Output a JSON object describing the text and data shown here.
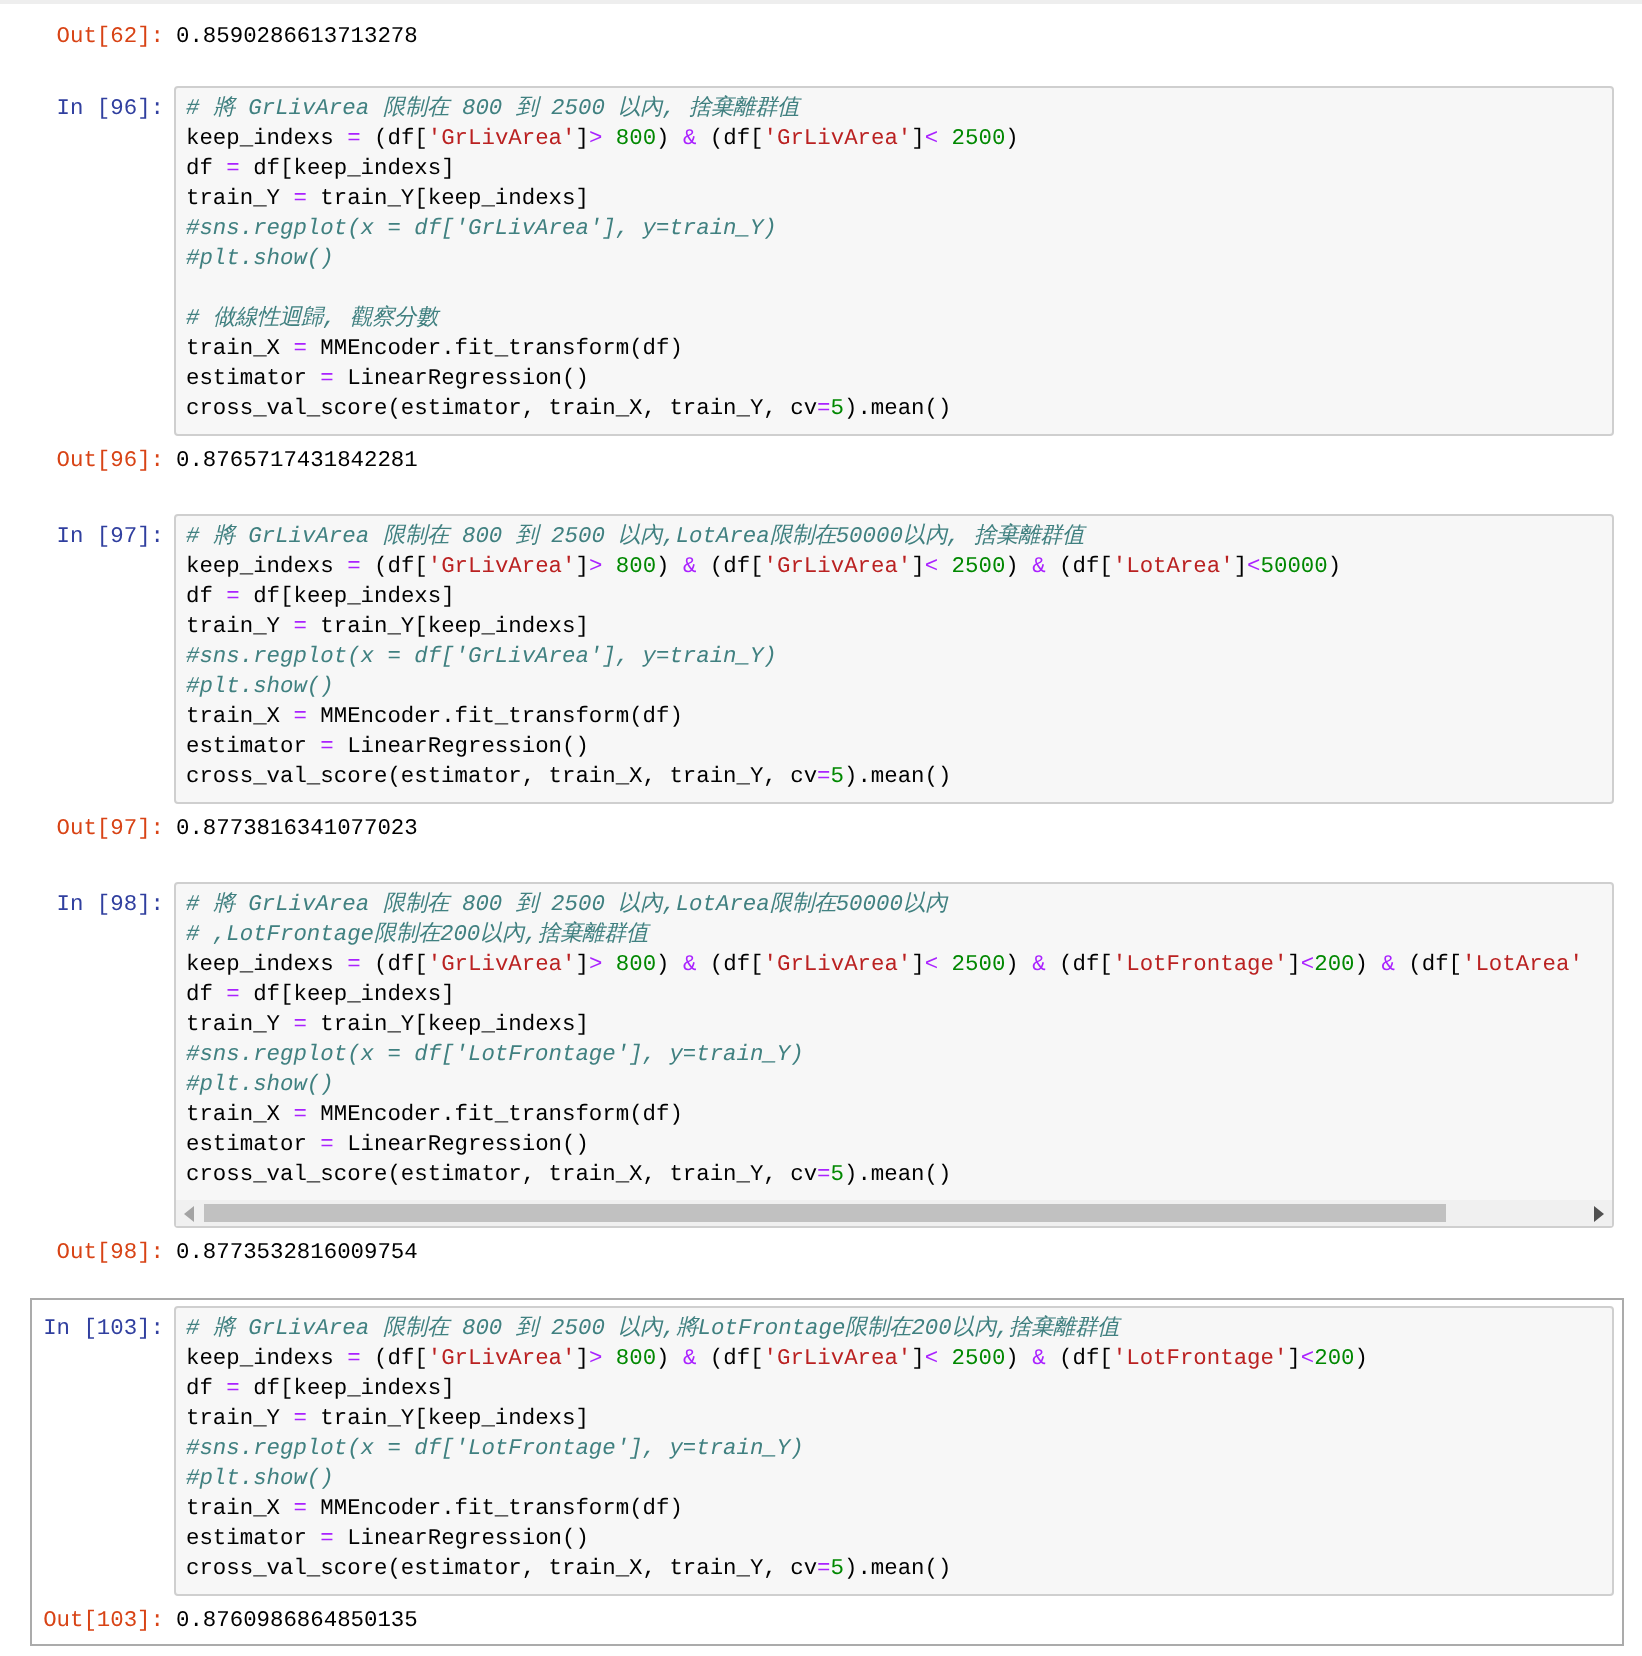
{
  "cells": [
    {
      "selected": false,
      "output_prompt": "Out[62]:",
      "output": "0.8590286613713278"
    },
    {
      "selected": false,
      "input_prompt": "In [96]:",
      "scrollbar": false,
      "lines": [
        {
          "kind": "comment",
          "text": "# 將 GrLivArea 限制在 800 到 2500 以內, 捨棄離群值"
        },
        {
          "kind": "code",
          "text": "keep_indexs = (df['GrLivArea']> 800) & (df['GrLivArea']< 2500)"
        },
        {
          "kind": "code",
          "text": "df = df[keep_indexs]"
        },
        {
          "kind": "code",
          "text": "train_Y = train_Y[keep_indexs]"
        },
        {
          "kind": "comment",
          "text": "#sns.regplot(x = df['GrLivArea'], y=train_Y)"
        },
        {
          "kind": "comment",
          "text": "#plt.show()"
        },
        {
          "kind": "blank"
        },
        {
          "kind": "comment",
          "text": "# 做線性迴歸, 觀察分數"
        },
        {
          "kind": "code",
          "text": "train_X = MMEncoder.fit_transform(df)"
        },
        {
          "kind": "code",
          "text": "estimator = LinearRegression()"
        },
        {
          "kind": "code",
          "text": "cross_val_score(estimator, train_X, train_Y, cv=5).mean()"
        }
      ],
      "output_prompt": "Out[96]:",
      "output": "0.8765717431842281"
    },
    {
      "selected": false,
      "input_prompt": "In [97]:",
      "scrollbar": false,
      "lines": [
        {
          "kind": "comment",
          "text": "# 將 GrLivArea 限制在 800 到 2500 以內,LotArea限制在50000以內, 捨棄離群值"
        },
        {
          "kind": "code",
          "text": "keep_indexs = (df['GrLivArea']> 800) & (df['GrLivArea']< 2500) & (df['LotArea']<50000)"
        },
        {
          "kind": "code",
          "text": "df = df[keep_indexs]"
        },
        {
          "kind": "code",
          "text": "train_Y = train_Y[keep_indexs]"
        },
        {
          "kind": "comment",
          "text": "#sns.regplot(x = df['GrLivArea'], y=train_Y)"
        },
        {
          "kind": "comment",
          "text": "#plt.show()"
        },
        {
          "kind": "code",
          "text": "train_X = MMEncoder.fit_transform(df)"
        },
        {
          "kind": "code",
          "text": "estimator = LinearRegression()"
        },
        {
          "kind": "code",
          "text": "cross_val_score(estimator, train_X, train_Y, cv=5).mean()"
        }
      ],
      "output_prompt": "Out[97]:",
      "output": "0.8773816341077023"
    },
    {
      "selected": false,
      "input_prompt": "In [98]:",
      "scrollbar": true,
      "lines": [
        {
          "kind": "comment",
          "text": "# 將 GrLivArea 限制在 800 到 2500 以內,LotArea限制在50000以內"
        },
        {
          "kind": "comment",
          "text": "# ,LotFrontage限制在200以內,捨棄離群值"
        },
        {
          "kind": "code",
          "text": "keep_indexs = (df['GrLivArea']> 800) & (df['GrLivArea']< 2500) & (df['LotFrontage']<200) & (df['LotArea'"
        },
        {
          "kind": "code",
          "text": "df = df[keep_indexs]"
        },
        {
          "kind": "code",
          "text": "train_Y = train_Y[keep_indexs]"
        },
        {
          "kind": "comment",
          "text": "#sns.regplot(x = df['LotFrontage'], y=train_Y)"
        },
        {
          "kind": "comment",
          "text": "#plt.show()"
        },
        {
          "kind": "code",
          "text": "train_X = MMEncoder.fit_transform(df)"
        },
        {
          "kind": "code",
          "text": "estimator = LinearRegression()"
        },
        {
          "kind": "code",
          "text": "cross_val_score(estimator, train_X, train_Y, cv=5).mean()"
        }
      ],
      "output_prompt": "Out[98]:",
      "output": "0.8773532816009754"
    },
    {
      "selected": true,
      "input_prompt": "In [103]:",
      "scrollbar": false,
      "lines": [
        {
          "kind": "comment",
          "text": "# 將 GrLivArea 限制在 800 到 2500 以內,將LotFrontage限制在200以內,捨棄離群值"
        },
        {
          "kind": "code",
          "text": "keep_indexs = (df['GrLivArea']> 800) & (df['GrLivArea']< 2500) & (df['LotFrontage']<200)"
        },
        {
          "kind": "code",
          "text": "df = df[keep_indexs]"
        },
        {
          "kind": "code",
          "text": "train_Y = train_Y[keep_indexs]"
        },
        {
          "kind": "comment",
          "text": "#sns.regplot(x = df['LotFrontage'], y=train_Y)"
        },
        {
          "kind": "comment",
          "text": "#plt.show()"
        },
        {
          "kind": "code",
          "text": "train_X = MMEncoder.fit_transform(df)"
        },
        {
          "kind": "code",
          "text": "estimator = LinearRegression()"
        },
        {
          "kind": "code",
          "text": "cross_val_score(estimator, train_X, train_Y, cv=5).mean()"
        }
      ],
      "output_prompt": "Out[103]:",
      "output": "0.8760986864850135"
    }
  ]
}
